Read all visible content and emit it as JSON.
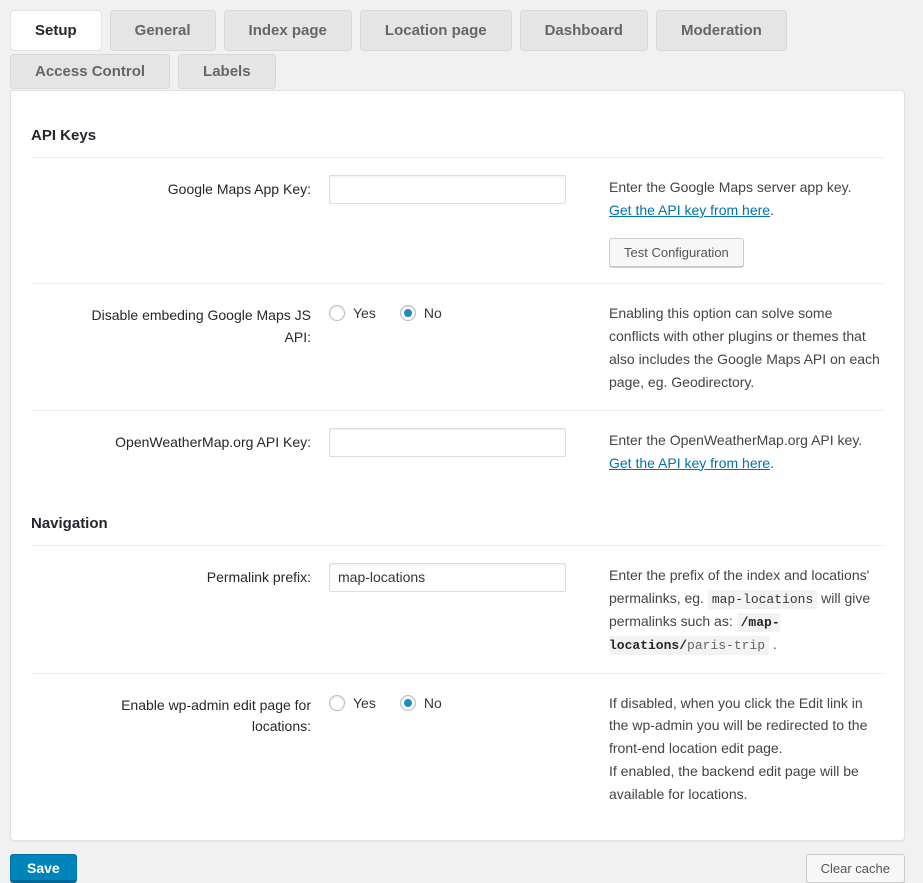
{
  "colors": {
    "primary_button": "#0085ba",
    "primary_button_border": "#006799",
    "link": "#0073aa",
    "radio_selected": "#1e8cbe",
    "page_background": "#f1f1f1",
    "inactive_tab_background": "#e5e5e5",
    "active_tab_background": "#ffffff"
  },
  "tabs": {
    "row1": [
      {
        "label": "Setup",
        "active": true
      },
      {
        "label": "General",
        "active": false
      },
      {
        "label": "Index page",
        "active": false
      },
      {
        "label": "Location page",
        "active": false
      },
      {
        "label": "Dashboard",
        "active": false
      },
      {
        "label": "Moderation",
        "active": false
      }
    ],
    "row2": [
      {
        "label": "Access Control",
        "active": false
      },
      {
        "label": "Labels",
        "active": false
      }
    ]
  },
  "sections": {
    "api_keys": {
      "title": "API Keys"
    },
    "navigation": {
      "title": "Navigation"
    }
  },
  "rows": {
    "gmaps_key": {
      "label": "Google Maps App Key:",
      "value": "",
      "desc": "Enter the Google Maps server app key.",
      "link": "Get the API key from here",
      "after_link": ".",
      "test_button": "Test Configuration"
    },
    "disable_embed": {
      "label": "Disable embeding Google Maps JS API:",
      "options": {
        "yes": "Yes",
        "no": "No"
      },
      "selected": "No",
      "desc": "Enabling this option can solve some conflicts with other plugins or themes that also includes the Google Maps API on each page, eg. Geodirectory."
    },
    "owm_key": {
      "label": "OpenWeatherMap.org API Key:",
      "value": "",
      "desc": "Enter the OpenWeatherMap.org API key.",
      "link": "Get the API key from here",
      "after_link": "."
    },
    "permalink": {
      "label": "Permalink prefix:",
      "value": "map-locations",
      "desc_part1": "Enter the prefix of the index and locations' permalinks, eg. ",
      "code1": "map-locations",
      "desc_part2": " will give permalinks such as: ",
      "code2_bold": "/map-locations/",
      "code2_rest": "paris-trip",
      "desc_part3": " ."
    },
    "wpadmin_edit": {
      "label": "Enable wp-admin edit page for locations:",
      "options": {
        "yes": "Yes",
        "no": "No"
      },
      "selected": "No",
      "desc_line1": "If disabled, when you click the Edit link in the wp-admin you will be redirected to the front-end location edit page.",
      "desc_line2": "If enabled, the backend edit page will be available for locations."
    }
  },
  "footer": {
    "save": "Save",
    "clear_cache": "Clear cache"
  }
}
